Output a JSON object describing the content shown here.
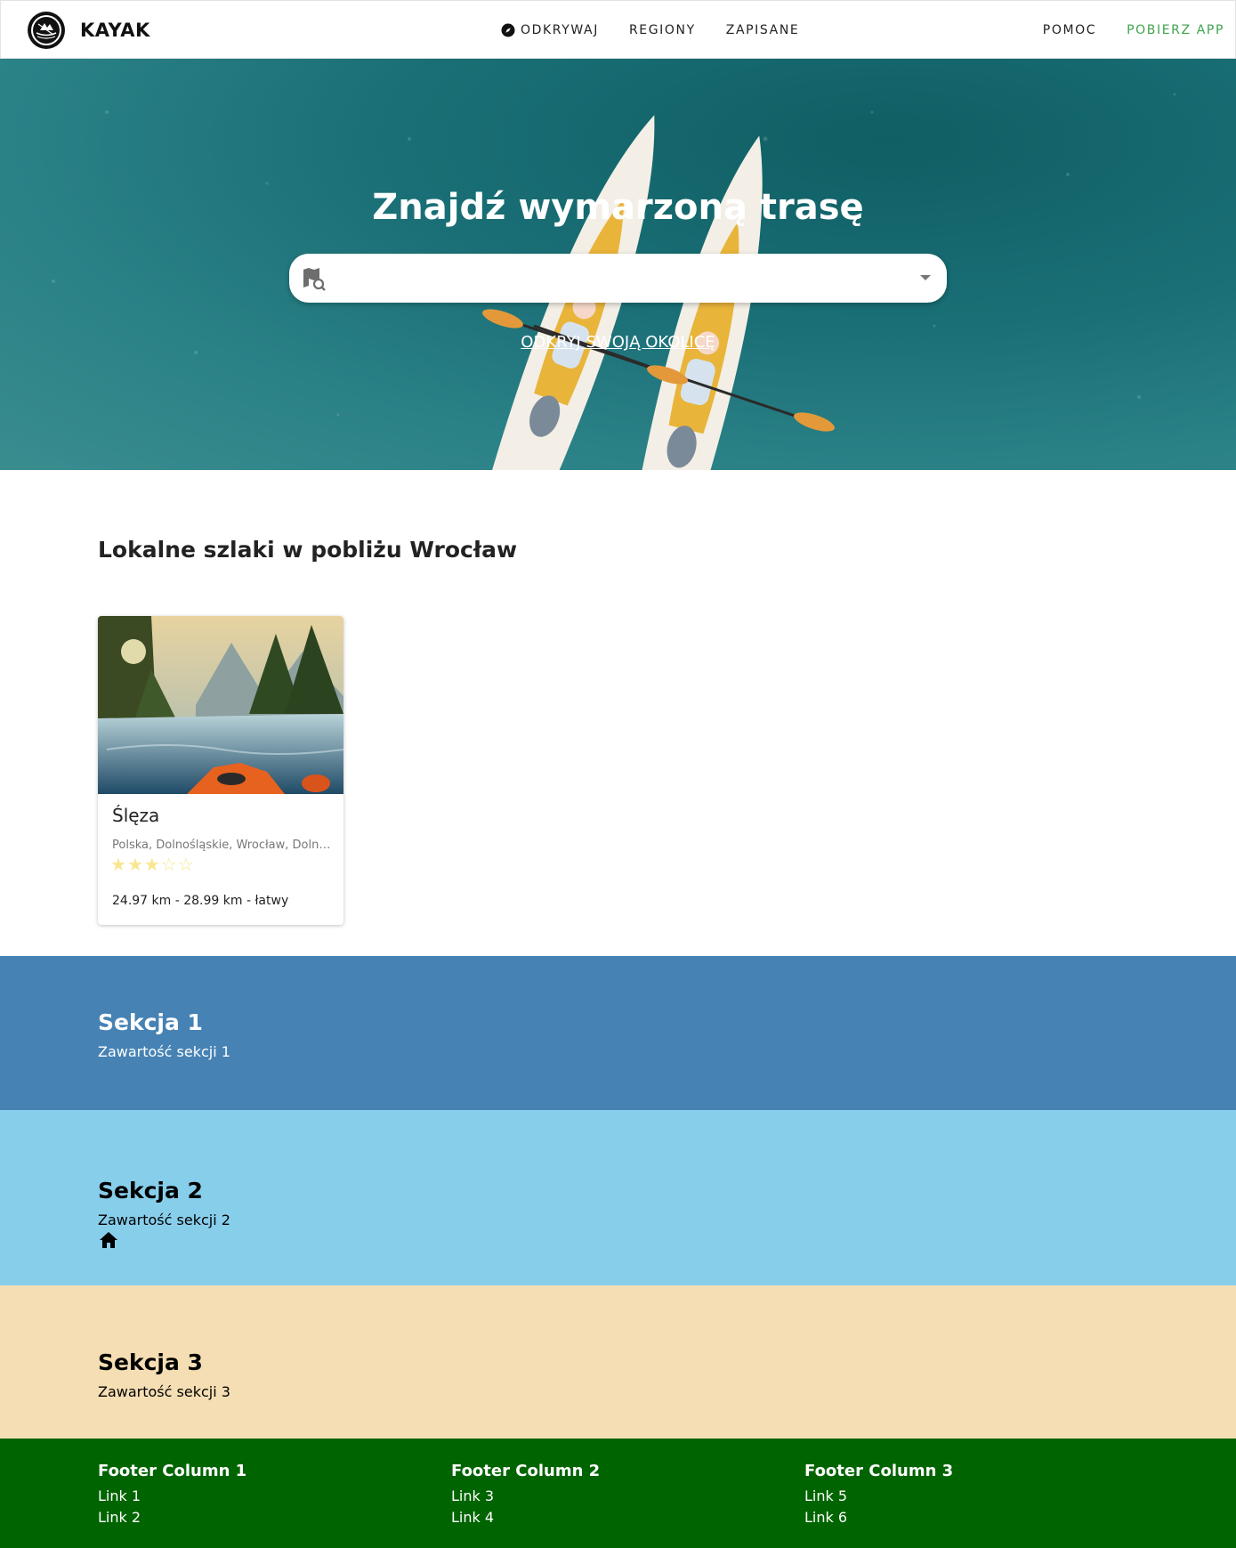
{
  "header": {
    "brand": "KAYAK",
    "nav_center": [
      "ODKRYWAJ",
      "REGIONY",
      "ZAPISANE"
    ],
    "nav_right": [
      "POMOC",
      "POBIERZ APP"
    ],
    "accent_color": "#3fa34d"
  },
  "hero": {
    "title": "Znajdź wymarzoną trasę",
    "search_value": "",
    "discover_link": "ODKRYJ SWOJĄ OKOLICĘ"
  },
  "local": {
    "title": "Lokalne szlaki w pobliżu Wrocław",
    "cards": [
      {
        "name": "Ślęza",
        "location": "Polska, Dolnośląskie, Wrocław, Dolnośląskie",
        "rating": 3,
        "rating_max": 5,
        "meta": "24.97 km - 28.99 km - łatwy"
      }
    ]
  },
  "sections": [
    {
      "title": "Sekcja 1",
      "content": "Zawartość sekcji 1",
      "color": "#4682b4"
    },
    {
      "title": "Sekcja 2",
      "content": "Zawartość sekcji 2",
      "color": "#87ceeb"
    },
    {
      "title": "Sekcja 3",
      "content": "Zawartość sekcji 3",
      "color": "#f5deb3"
    }
  ],
  "footer": {
    "color": "#006400",
    "columns": [
      {
        "title": "Footer Column 1",
        "links": [
          "Link 1",
          "Link 2"
        ]
      },
      {
        "title": "Footer Column 2",
        "links": [
          "Link 3",
          "Link 4"
        ]
      },
      {
        "title": "Footer Column 3",
        "links": [
          "Link 5",
          "Link 6"
        ]
      }
    ]
  }
}
